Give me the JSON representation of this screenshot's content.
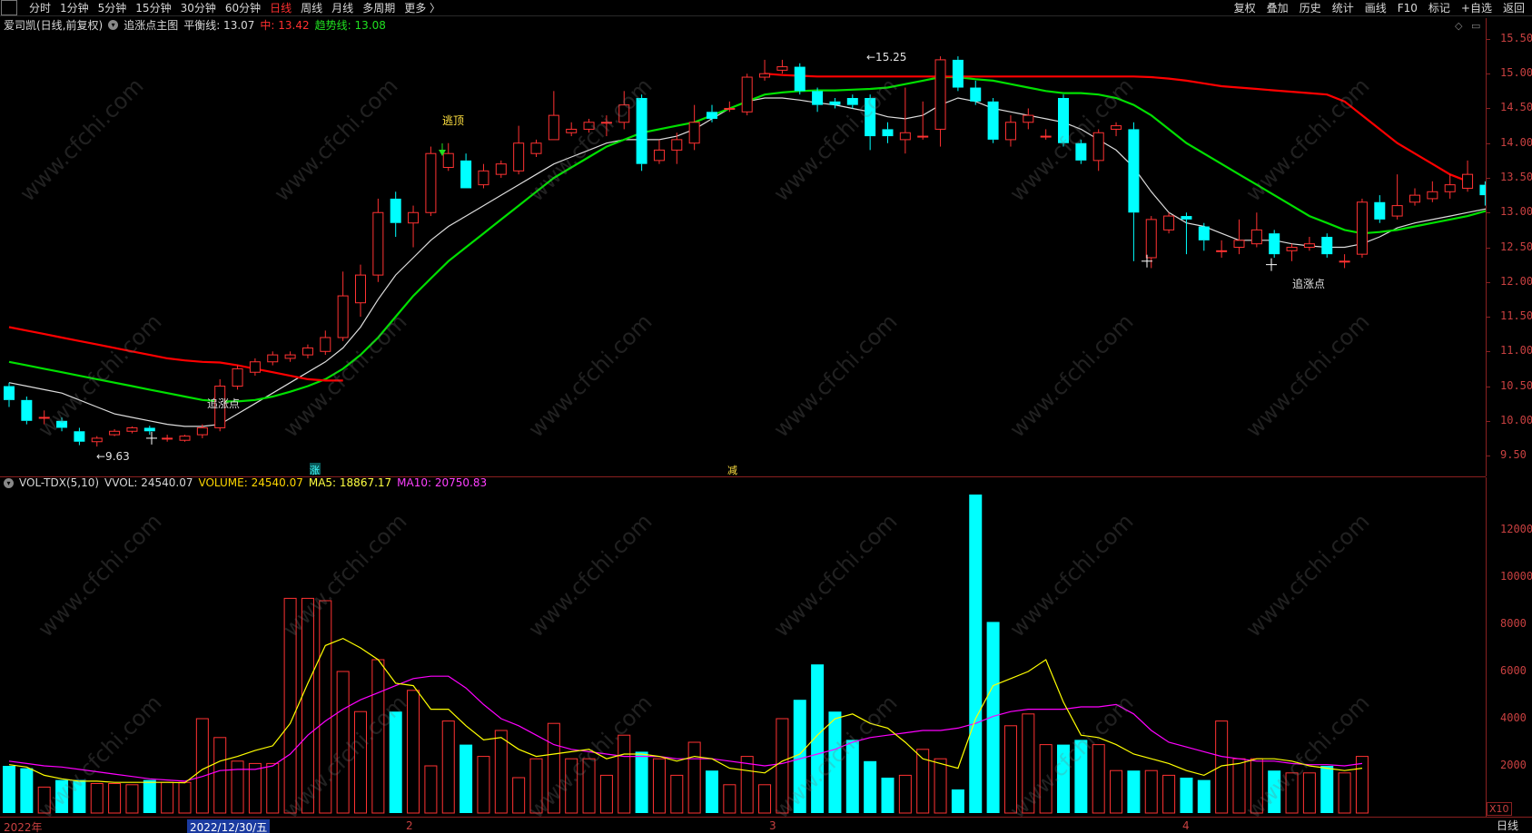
{
  "toolbar": {
    "periods": [
      "分时",
      "1分钟",
      "5分钟",
      "15分钟",
      "30分钟",
      "60分钟",
      "日线",
      "周线",
      "月线",
      "多周期",
      "更多 〉"
    ],
    "active_period": "日线",
    "right_items": [
      "复权",
      "叠加",
      "历史",
      "统计",
      "画线",
      "F10",
      "标记",
      "+自选",
      "返回"
    ]
  },
  "price_info": {
    "stock": "爱司凯(日线,前复权)",
    "indicator": "追涨点主图",
    "balance_label": "平衡线: 13.07",
    "mid_label": "中: 13.42",
    "trend_label": "趋势线: 13.08"
  },
  "vol_info": {
    "name": "VOL-TDX(5,10)",
    "vvol": "VVOL: 24540.07",
    "volume": "VOLUME: 24540.07",
    "ma5": "MA5: 18867.17",
    "ma10": "MA10: 20750.83"
  },
  "price_axis": [
    "15.50",
    "15.00",
    "14.50",
    "14.00",
    "13.50",
    "13.00",
    "12.50",
    "12.00",
    "11.50",
    "11.00",
    "10.50",
    "10.00",
    "9.50"
  ],
  "vol_axis": [
    "12000",
    "10000",
    "8000",
    "6000",
    "4000",
    "2000"
  ],
  "vol_axis_unit": "X10",
  "dates": [
    "2022年",
    "2022/12/30/五",
    "2",
    "3",
    "4"
  ],
  "bottom_right_label": "日线",
  "annotations": {
    "low_marker": "←9.63",
    "high_marker": "←15.25",
    "escape_top": "逃顶",
    "chase_point_1": "追涨点",
    "chase_point_2": "追涨点",
    "zhang": "涨",
    "jian": "减"
  },
  "watermark": "www.cfchi.com",
  "colors": {
    "up": "#ff3232",
    "down": "#00ffff",
    "mid_line": "#ff0000",
    "trend_line": "#00e000",
    "balance_line": "#dddddd",
    "ma5": "#ffff00",
    "ma10": "#ff00ff",
    "axis": "#c84040"
  },
  "chart_data": {
    "type": "candlestick",
    "price_range": [
      9.2,
      15.8
    ],
    "candles": [
      [
        10.5,
        10.3,
        10.55,
        10.2
      ],
      [
        10.3,
        10.0,
        10.35,
        9.95
      ],
      [
        10.05,
        10.05,
        10.15,
        9.95
      ],
      [
        10.0,
        9.9,
        10.05,
        9.85
      ],
      [
        9.85,
        9.7,
        9.9,
        9.65
      ],
      [
        9.7,
        9.75,
        9.78,
        9.63
      ],
      [
        9.8,
        9.85,
        9.88,
        9.78
      ],
      [
        9.85,
        9.9,
        9.92,
        9.82
      ],
      [
        9.9,
        9.85,
        9.93,
        9.8
      ],
      [
        9.75,
        9.75,
        9.8,
        9.7
      ],
      [
        9.72,
        9.78,
        9.8,
        9.7
      ],
      [
        9.8,
        9.9,
        9.95,
        9.75
      ],
      [
        9.9,
        10.5,
        10.6,
        9.85
      ],
      [
        10.5,
        10.75,
        10.8,
        10.45
      ],
      [
        10.7,
        10.85,
        10.9,
        10.65
      ],
      [
        10.85,
        10.95,
        11.0,
        10.8
      ],
      [
        10.9,
        10.95,
        11.0,
        10.85
      ],
      [
        10.95,
        11.05,
        11.1,
        10.9
      ],
      [
        11.0,
        11.2,
        11.3,
        10.95
      ],
      [
        11.2,
        11.8,
        12.15,
        11.15
      ],
      [
        11.7,
        12.1,
        12.25,
        11.5
      ],
      [
        12.1,
        13.0,
        13.2,
        12.0
      ],
      [
        13.2,
        12.85,
        13.3,
        12.65
      ],
      [
        12.85,
        13.0,
        13.1,
        12.5
      ],
      [
        13.0,
        13.85,
        13.95,
        12.95
      ],
      [
        13.65,
        13.85,
        14.0,
        13.6
      ],
      [
        13.75,
        13.35,
        13.85,
        13.35
      ],
      [
        13.4,
        13.6,
        13.7,
        13.35
      ],
      [
        13.55,
        13.7,
        13.75,
        13.5
      ],
      [
        13.6,
        14.0,
        14.25,
        13.55
      ],
      [
        13.85,
        14.0,
        14.05,
        13.8
      ],
      [
        14.05,
        14.4,
        14.75,
        14.05
      ],
      [
        14.15,
        14.2,
        14.3,
        14.1
      ],
      [
        14.2,
        14.3,
        14.35,
        14.15
      ],
      [
        14.3,
        14.3,
        14.4,
        14.1
      ],
      [
        14.3,
        14.55,
        14.75,
        14.2
      ],
      [
        14.65,
        13.7,
        14.7,
        13.6
      ],
      [
        13.75,
        13.9,
        14.05,
        13.7
      ],
      [
        13.9,
        14.05,
        14.15,
        13.7
      ],
      [
        14.0,
        14.3,
        14.55,
        13.9
      ],
      [
        14.45,
        14.35,
        14.55,
        14.3
      ],
      [
        14.5,
        14.5,
        14.6,
        14.45
      ],
      [
        14.45,
        14.95,
        15.0,
        14.4
      ],
      [
        14.95,
        15.0,
        15.2,
        14.9
      ],
      [
        15.05,
        15.1,
        15.2,
        15.0
      ],
      [
        15.1,
        14.75,
        15.15,
        14.7
      ],
      [
        14.75,
        14.55,
        14.8,
        14.45
      ],
      [
        14.6,
        14.55,
        14.65,
        14.5
      ],
      [
        14.65,
        14.55,
        14.7,
        14.5
      ],
      [
        14.65,
        14.1,
        14.7,
        13.9
      ],
      [
        14.2,
        14.1,
        14.3,
        14.0
      ],
      [
        14.05,
        14.15,
        14.8,
        13.85
      ],
      [
        14.1,
        14.1,
        14.6,
        14.05
      ],
      [
        14.2,
        15.2,
        15.25,
        13.95
      ],
      [
        15.2,
        14.8,
        15.25,
        14.75
      ],
      [
        14.8,
        14.6,
        14.9,
        14.55
      ],
      [
        14.6,
        14.05,
        14.65,
        14.0
      ],
      [
        14.05,
        14.3,
        14.4,
        13.95
      ],
      [
        14.3,
        14.4,
        14.5,
        14.2
      ],
      [
        14.1,
        14.1,
        14.2,
        14.05
      ],
      [
        14.65,
        14.0,
        14.7,
        13.95
      ],
      [
        14.0,
        13.75,
        14.05,
        13.7
      ],
      [
        13.75,
        14.15,
        14.2,
        13.6
      ],
      [
        14.2,
        14.25,
        14.3,
        14.1
      ],
      [
        14.2,
        13.0,
        14.3,
        12.3
      ],
      [
        12.35,
        12.9,
        12.95,
        12.2
      ],
      [
        12.75,
        12.95,
        13.0,
        12.7
      ],
      [
        12.95,
        12.9,
        13.0,
        12.4
      ],
      [
        12.8,
        12.6,
        12.85,
        12.45
      ],
      [
        12.45,
        12.45,
        12.6,
        12.35
      ],
      [
        12.5,
        12.6,
        12.9,
        12.4
      ],
      [
        12.55,
        12.75,
        13.0,
        12.5
      ],
      [
        12.7,
        12.4,
        12.75,
        12.35
      ],
      [
        12.45,
        12.5,
        12.55,
        12.3
      ],
      [
        12.5,
        12.55,
        12.65,
        12.45
      ],
      [
        12.65,
        12.4,
        12.7,
        12.35
      ],
      [
        12.3,
        12.3,
        12.4,
        12.2
      ],
      [
        12.4,
        13.15,
        13.2,
        12.35
      ],
      [
        13.15,
        12.9,
        13.25,
        12.85
      ],
      [
        12.95,
        13.1,
        13.55,
        12.9
      ],
      [
        13.15,
        13.25,
        13.35,
        13.1
      ],
      [
        13.2,
        13.3,
        13.45,
        13.15
      ],
      [
        13.3,
        13.4,
        13.55,
        13.2
      ],
      [
        13.35,
        13.55,
        13.75,
        13.3
      ],
      [
        13.4,
        13.25,
        13.45,
        13.1
      ],
      [
        13.3,
        12.9,
        13.35,
        12.75
      ]
    ],
    "mid_line": [
      11.35,
      11.3,
      11.25,
      11.2,
      11.15,
      11.1,
      11.05,
      11.0,
      10.95,
      10.9,
      10.87,
      10.85,
      10.84,
      10.8,
      10.75,
      10.7,
      10.65,
      10.6,
      10.58,
      10.58,
      null,
      null,
      null,
      null,
      null,
      null,
      null,
      null,
      null,
      null,
      null,
      null,
      null,
      null,
      null,
      null,
      null,
      null,
      null,
      null,
      null,
      null,
      null,
      15.0,
      14.98,
      14.97,
      14.96,
      14.96,
      14.96,
      14.96,
      14.96,
      14.96,
      14.96,
      14.96,
      14.96,
      14.96,
      14.96,
      14.96,
      14.96,
      14.96,
      14.96,
      14.96,
      14.96,
      14.96,
      14.96,
      14.95,
      14.93,
      14.9,
      14.86,
      14.82,
      14.8,
      14.78,
      14.76,
      14.74,
      14.72,
      14.7,
      14.6,
      14.4,
      14.2,
      14.0,
      13.85,
      13.7,
      13.55,
      13.45
    ],
    "trend_line": [
      10.85,
      10.8,
      10.75,
      10.7,
      10.65,
      10.6,
      10.55,
      10.5,
      10.45,
      10.4,
      10.35,
      10.3,
      10.28,
      10.28,
      10.3,
      10.35,
      10.42,
      10.5,
      10.6,
      10.75,
      10.95,
      11.2,
      11.5,
      11.8,
      12.05,
      12.3,
      12.5,
      12.7,
      12.9,
      13.1,
      13.3,
      13.5,
      13.65,
      13.8,
      13.95,
      14.05,
      14.15,
      14.2,
      14.25,
      14.3,
      14.4,
      14.5,
      14.6,
      14.7,
      14.73,
      14.75,
      14.76,
      14.76,
      14.77,
      14.78,
      14.8,
      14.85,
      14.9,
      14.95,
      14.95,
      14.92,
      14.9,
      14.85,
      14.8,
      14.75,
      14.72,
      14.72,
      14.7,
      14.65,
      14.55,
      14.4,
      14.2,
      14.0,
      13.85,
      13.7,
      13.55,
      13.4,
      13.25,
      13.1,
      12.95,
      12.85,
      12.75,
      12.7,
      12.72,
      12.75,
      12.8,
      12.85,
      12.9,
      12.95,
      13.02,
      13.07,
      13.08
    ],
    "balance_line": [
      10.55,
      10.5,
      10.45,
      10.4,
      10.3,
      10.2,
      10.1,
      10.05,
      10.0,
      9.95,
      9.92,
      9.92,
      9.95,
      10.1,
      10.25,
      10.4,
      10.55,
      10.7,
      10.85,
      11.05,
      11.35,
      11.75,
      12.1,
      12.35,
      12.6,
      12.8,
      12.95,
      13.1,
      13.25,
      13.4,
      13.55,
      13.7,
      13.8,
      13.9,
      14.0,
      14.05,
      14.05,
      14.05,
      14.1,
      14.2,
      14.35,
      14.5,
      14.6,
      14.65,
      14.65,
      14.62,
      14.58,
      14.55,
      14.5,
      14.45,
      14.38,
      14.35,
      14.4,
      14.55,
      14.65,
      14.6,
      14.5,
      14.45,
      14.4,
      14.35,
      14.3,
      14.2,
      14.05,
      13.9,
      13.65,
      13.3,
      13.0,
      12.85,
      12.8,
      12.7,
      12.6,
      12.6,
      12.6,
      12.55,
      12.52,
      12.5,
      12.5,
      12.55,
      12.65,
      12.78,
      12.85,
      12.9,
      12.95,
      13.0,
      13.05,
      13.07,
      13.07
    ],
    "volume": [
      2000,
      1900,
      1100,
      1400,
      1400,
      1250,
      1250,
      1200,
      1400,
      1300,
      1300,
      4000,
      3200,
      2200,
      2100,
      2100,
      9100,
      9100,
      9000,
      6000,
      4300,
      6500,
      4300,
      5200,
      2000,
      3900,
      2900,
      2400,
      3500,
      1500,
      2300,
      3800,
      2300,
      2300,
      1600,
      3300,
      2600,
      2300,
      1600,
      3000,
      1800,
      1200,
      2400,
      1200,
      4000,
      4800,
      6300,
      4300,
      3100,
      2200,
      1500,
      1600,
      2700,
      2300,
      1000,
      13500,
      8100,
      3700,
      4200,
      2900,
      2900,
      3100,
      2900,
      1800,
      1800,
      1800,
      1600,
      1500,
      1400,
      3900,
      2300,
      2300,
      1800,
      1700,
      1700,
      2000,
      1700,
      2400
    ],
    "ma5": [
      2050,
      1950,
      1600,
      1450,
      1350,
      1350,
      1300,
      1300,
      1300,
      1300,
      1280,
      1850,
      2200,
      2400,
      2650,
      2850,
      3800,
      5500,
      7100,
      7400,
      7000,
      6500,
      5500,
      5400,
      4400,
      4400,
      3700,
      3100,
      3200,
      2700,
      2400,
      2500,
      2600,
      2700,
      2300,
      2500,
      2500,
      2400,
      2200,
      2400,
      2300,
      1900,
      1800,
      1700,
      2200,
      2500,
      3300,
      4000,
      4200,
      3800,
      3600,
      3000,
      2300,
      2100,
      1900,
      4000,
      5400,
      5700,
      6000,
      6500,
      4700,
      3300,
      3200,
      2900,
      2500,
      2300,
      2100,
      1800,
      1600,
      2000,
      2100,
      2300,
      2300,
      2200,
      2000,
      1900,
      1800,
      1900
    ],
    "ma10": [
      2200,
      2100,
      2000,
      1950,
      1850,
      1750,
      1650,
      1550,
      1450,
      1400,
      1350,
      1550,
      1800,
      1850,
      1850,
      2000,
      2500,
      3300,
      3900,
      4400,
      4800,
      5100,
      5400,
      5700,
      5800,
      5800,
      5300,
      4600,
      4000,
      3700,
      3300,
      2900,
      2700,
      2600,
      2500,
      2400,
      2400,
      2400,
      2300,
      2300,
      2300,
      2200,
      2100,
      2000,
      2100,
      2300,
      2500,
      2700,
      3000,
      3200,
      3300,
      3400,
      3500,
      3500,
      3600,
      3800,
      4100,
      4300,
      4400,
      4400,
      4400,
      4500,
      4500,
      4600,
      4200,
      3500,
      3000,
      2800,
      2600,
      2400,
      2300,
      2200,
      2200,
      2100,
      2050,
      2050,
      2000,
      2100
    ]
  }
}
